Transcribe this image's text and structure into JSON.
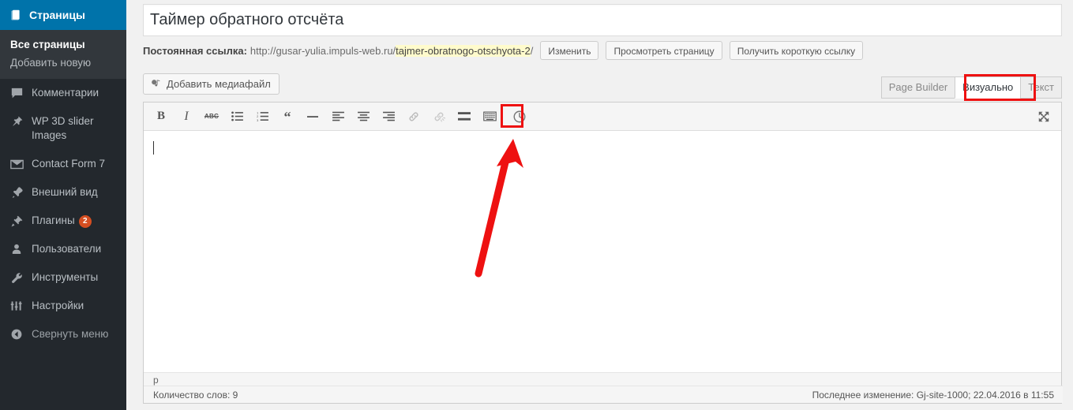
{
  "sidebar": {
    "active_menu": {
      "label": "Страницы",
      "icon": "pages-icon"
    },
    "submenu": [
      {
        "label": "Все страницы",
        "current": true
      },
      {
        "label": "Добавить новую",
        "current": false
      }
    ],
    "items": [
      {
        "label": "Комментарии",
        "icon": "comment-icon",
        "badge": ""
      },
      {
        "label": "WP 3D slider Images",
        "icon": "pin-icon",
        "badge": ""
      },
      {
        "label": "Contact Form 7",
        "icon": "envelope-icon",
        "badge": ""
      },
      {
        "label": "Внешний вид",
        "icon": "appearance-brush-icon",
        "badge": ""
      },
      {
        "label": "Плагины",
        "icon": "plugin-icon",
        "badge": "2"
      },
      {
        "label": "Пользователи",
        "icon": "user-icon",
        "badge": ""
      },
      {
        "label": "Инструменты",
        "icon": "wrench-icon",
        "badge": ""
      },
      {
        "label": "Настройки",
        "icon": "settings-sliders-icon",
        "badge": ""
      }
    ],
    "collapse": {
      "label": "Свернуть меню",
      "icon": "collapse-arrow-icon"
    }
  },
  "post": {
    "title": "Таймер обратного отсчёта",
    "title_placeholder": "Введите заголовок"
  },
  "permalink": {
    "label": "Постоянная ссылка:",
    "base_url": "http://gusar-yulia.impuls-web.ru/",
    "slug": "tajmer-obratnogo-otschyota-2",
    "trailing_slash": "/",
    "buttons": [
      {
        "label": "Изменить",
        "name": "edit-permalink-button"
      },
      {
        "label": "Просмотреть страницу",
        "name": "view-page-button"
      },
      {
        "label": "Получить короткую ссылку",
        "name": "get-shortlink-button"
      }
    ]
  },
  "editor": {
    "add_media_label": "Добавить медиафайл",
    "add_media_icon": "media-add-icon",
    "tabs": [
      {
        "label": "Page Builder",
        "active": false,
        "highlight": false
      },
      {
        "label": "Визуально",
        "active": true,
        "highlight": true
      },
      {
        "label": "Текст",
        "active": false,
        "highlight": false
      }
    ],
    "toolbar": [
      {
        "name": "bold-button",
        "icon": "bold-icon",
        "glyph": "B",
        "style": "bold-i",
        "dim": false,
        "highlight": false
      },
      {
        "name": "italic-button",
        "icon": "italic-icon",
        "glyph": "I",
        "style": "ital-i",
        "dim": false,
        "highlight": false
      },
      {
        "name": "strikethrough-button",
        "icon": "strikethrough-abc-icon",
        "glyph": "",
        "style": "",
        "dim": false,
        "highlight": false
      },
      {
        "name": "bulleted-list-button",
        "icon": "bulleted-list-icon",
        "glyph": "",
        "style": "",
        "dim": false,
        "highlight": false
      },
      {
        "name": "numbered-list-button",
        "icon": "numbered-list-icon",
        "glyph": "",
        "style": "",
        "dim": false,
        "highlight": false
      },
      {
        "name": "blockquote-button",
        "icon": "quote-icon",
        "glyph": "",
        "style": "",
        "dim": false,
        "highlight": false
      },
      {
        "name": "horizontal-rule-button",
        "icon": "horizontal-rule-icon",
        "glyph": "",
        "style": "",
        "dim": false,
        "highlight": false
      },
      {
        "name": "align-left-button",
        "icon": "align-left-icon",
        "glyph": "",
        "style": "",
        "dim": false,
        "highlight": false
      },
      {
        "name": "align-center-button",
        "icon": "align-center-icon",
        "glyph": "",
        "style": "",
        "dim": false,
        "highlight": false
      },
      {
        "name": "align-right-button",
        "icon": "align-right-icon",
        "glyph": "",
        "style": "",
        "dim": false,
        "highlight": false
      },
      {
        "name": "insert-link-button",
        "icon": "link-icon",
        "glyph": "",
        "style": "",
        "dim": true,
        "highlight": false
      },
      {
        "name": "remove-link-button",
        "icon": "unlink-icon",
        "glyph": "",
        "style": "",
        "dim": true,
        "highlight": false
      },
      {
        "name": "read-more-button",
        "icon": "more-tag-icon",
        "glyph": "",
        "style": "",
        "dim": false,
        "highlight": false
      },
      {
        "name": "toolbar-toggle-button",
        "icon": "keyboard-toolbar-icon",
        "glyph": "",
        "style": "",
        "dim": false,
        "highlight": false
      },
      {
        "name": "countdown-timer-button",
        "icon": "clock-icon",
        "glyph": "",
        "style": "",
        "dim": false,
        "highlight": true
      }
    ],
    "fullscreen_icon": "fullscreen-expand-icon",
    "content": "",
    "path_bar": "p",
    "word_count": "Количество слов: 9",
    "last_edit": "Последнее изменение: Gj-site-1000; 22.04.2016 в 11:55"
  },
  "annotations": {
    "arrow_color": "#ee1111",
    "highlight_color": "#ee1111"
  }
}
